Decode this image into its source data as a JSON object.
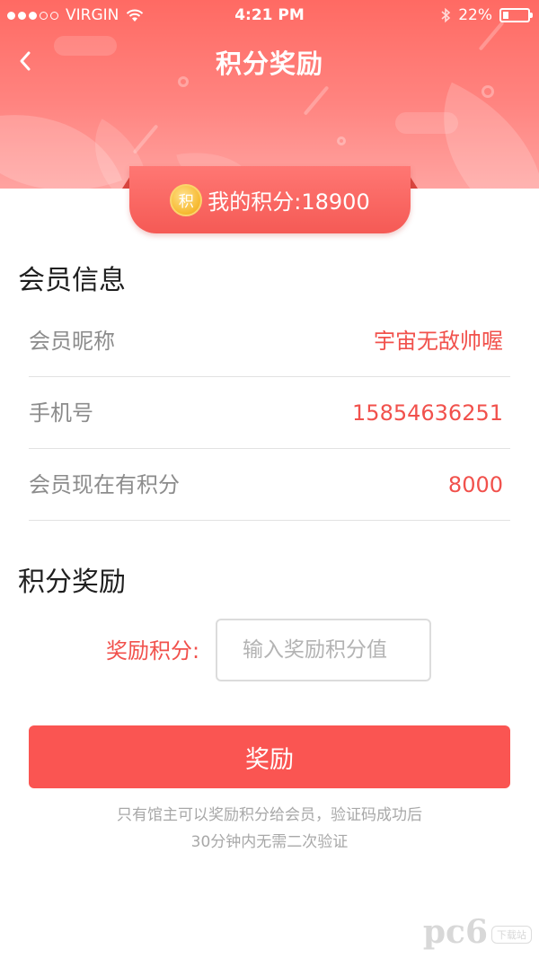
{
  "status_bar": {
    "carrier": "VIRGIN",
    "time": "4:21 PM",
    "battery": "22%",
    "battery_level": 0.22
  },
  "nav": {
    "title": "积分奖励",
    "back_icon": "chevron-left-icon"
  },
  "points_banner": {
    "coin_char": "积",
    "text": "我的积分:18900"
  },
  "member_info": {
    "title": "会员信息",
    "rows": [
      {
        "label": "会员昵称",
        "value": "宇宙无敌帅喔"
      },
      {
        "label": "手机号",
        "value": "15854636251"
      },
      {
        "label": "会员现在有积分",
        "value": "8000"
      }
    ]
  },
  "reward": {
    "title": "积分奖励",
    "label": "奖励积分:",
    "placeholder": "输入奖励积分值",
    "value": ""
  },
  "submit": {
    "label": "奖励"
  },
  "note": {
    "line1": "只有馆主可以奖励积分给会员，验证码成功后",
    "line2": "30分钟内无需二次验证"
  },
  "watermark": {
    "logo": "pc6",
    "sub": "下载站"
  },
  "colors": {
    "accent": "#fa5552",
    "value_text": "#f1514c",
    "header_top": "#ff6a63",
    "divider": "#e2e2e2"
  }
}
